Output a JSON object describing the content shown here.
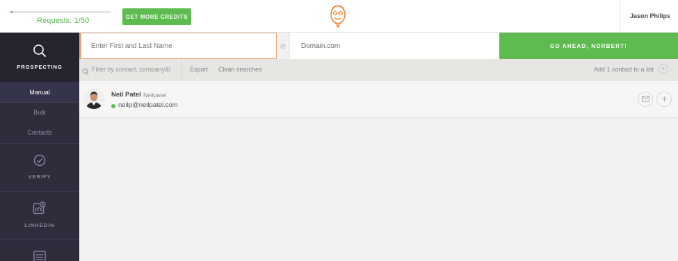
{
  "topbar": {
    "requests_label": "Requests: 1/50",
    "requests_progress": 0.02,
    "credits_button": "GET MORE CREDITS",
    "user_name": "Jason Philips"
  },
  "sidebar": {
    "prospecting_label": "PROSPECTING",
    "sub_items": [
      "Manual",
      "Bulk",
      "Contacts"
    ],
    "verify_label": "VERIFY",
    "linkedin_label": "LINKEDIN"
  },
  "search": {
    "name_placeholder": "Enter First and Last Name",
    "at_symbol": "@",
    "domain_placeholder": "Domain.com",
    "go_button": "GO AHEAD, NORBERT!"
  },
  "filter": {
    "placeholder": "Filter by contact, company&l",
    "export_label": "Export",
    "clean_label": "Clean searches",
    "add_list_label": "Add 1 contact to a list",
    "add_list_symbol": "+"
  },
  "contacts": [
    {
      "name": "Neil Patel",
      "handle": "Neilpatel",
      "email": "neilp@neilpatel.com"
    }
  ],
  "colors": {
    "accent_green": "#5dbb4f",
    "sidebar_bg": "#2d2d3c",
    "logo_orange": "#e8893b"
  }
}
